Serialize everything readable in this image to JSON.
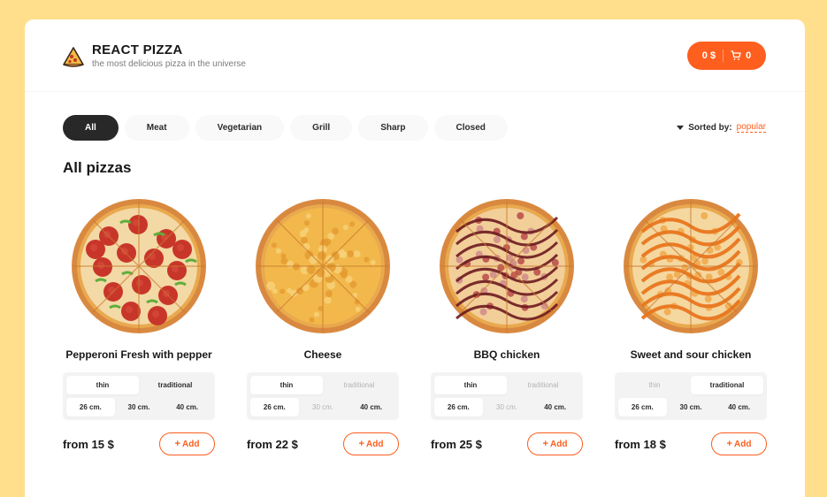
{
  "header": {
    "title": "REACT PIZZA",
    "subtitle": "the most delicious pizza in the universe",
    "cart": {
      "price": "0 $",
      "count": "0"
    }
  },
  "categories": [
    "All",
    "Meat",
    "Vegetarian",
    "Grill",
    "Sharp",
    "Closed"
  ],
  "active_category": "All",
  "sort": {
    "label": "Sorted by:",
    "value": "popular"
  },
  "content_title": "All pizzas",
  "add_label": "Add",
  "pizzas": [
    {
      "title": "Pepperoni Fresh with pepper",
      "price": "from 15 $",
      "types": [
        {
          "label": "thin",
          "state": "active"
        },
        {
          "label": "traditional",
          "state": "normal"
        }
      ],
      "sizes": [
        {
          "label": "26 cm.",
          "state": "active"
        },
        {
          "label": "30 cm.",
          "state": "normal"
        },
        {
          "label": "40 cm.",
          "state": "normal"
        }
      ],
      "style": "pepperoni"
    },
    {
      "title": "Cheese",
      "price": "from 22 $",
      "types": [
        {
          "label": "thin",
          "state": "active"
        },
        {
          "label": "traditional",
          "state": "disabled"
        }
      ],
      "sizes": [
        {
          "label": "26 cm.",
          "state": "active"
        },
        {
          "label": "30 cm.",
          "state": "disabled"
        },
        {
          "label": "40 cm.",
          "state": "normal"
        }
      ],
      "style": "cheese"
    },
    {
      "title": "BBQ chicken",
      "price": "from 25 $",
      "types": [
        {
          "label": "thin",
          "state": "active"
        },
        {
          "label": "traditional",
          "state": "disabled"
        }
      ],
      "sizes": [
        {
          "label": "26 cm.",
          "state": "active"
        },
        {
          "label": "30 cm.",
          "state": "disabled"
        },
        {
          "label": "40 cm.",
          "state": "normal"
        }
      ],
      "style": "bbq"
    },
    {
      "title": "Sweet and sour chicken",
      "price": "from 18 $",
      "types": [
        {
          "label": "thin",
          "state": "disabled"
        },
        {
          "label": "traditional",
          "state": "active"
        }
      ],
      "sizes": [
        {
          "label": "26 cm.",
          "state": "active"
        },
        {
          "label": "30 cm.",
          "state": "normal"
        },
        {
          "label": "40 cm.",
          "state": "normal"
        }
      ],
      "style": "sweetsour"
    }
  ],
  "colors": {
    "accent": "#FE5F1E",
    "background": "#FFDF8C",
    "dark": "#282828"
  },
  "icons": {
    "logo": "pizza-slice-icon",
    "cart": "cart-icon",
    "sort": "caret-down-icon",
    "add": "plus-icon"
  }
}
